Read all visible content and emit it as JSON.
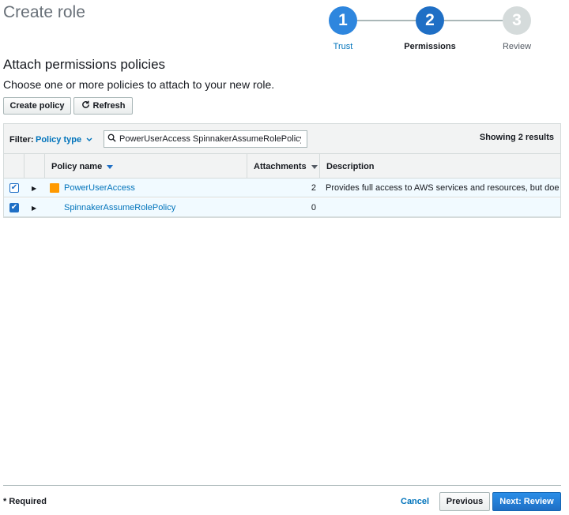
{
  "page": {
    "title": "Create role"
  },
  "stepper": {
    "steps": [
      {
        "number": "1",
        "label": "Trust"
      },
      {
        "number": "2",
        "label": "Permissions"
      },
      {
        "number": "3",
        "label": "Review"
      }
    ]
  },
  "section": {
    "title": "Attach permissions policies",
    "subtitle": "Choose one or more policies to attach to your new role."
  },
  "toolbar": {
    "create_policy_label": "Create policy",
    "refresh_label": "Refresh"
  },
  "filter": {
    "label": "Filter:",
    "type_label": "Policy type",
    "search_value": "PowerUserAccess SpinnakerAssumeRolePolicy",
    "showing": "Showing 2 results"
  },
  "table": {
    "columns": [
      "Policy name",
      "Attachments",
      "Description"
    ],
    "rows": [
      {
        "checked": true,
        "name": "PowerUserAccess",
        "attachments": "2",
        "description": "Provides full access to AWS services and resources, but doe...",
        "aws_managed": true
      },
      {
        "checked": true,
        "name": "SpinnakerAssumeRolePolicy",
        "attachments": "0",
        "description": "",
        "aws_managed": false
      }
    ]
  },
  "footer": {
    "required": "* Required",
    "cancel": "Cancel",
    "previous": "Previous",
    "next": "Next: Review"
  },
  "colors": {
    "accent": "#1f6fc5",
    "link": "#0073bb",
    "aws_icon": "#ff9900"
  }
}
